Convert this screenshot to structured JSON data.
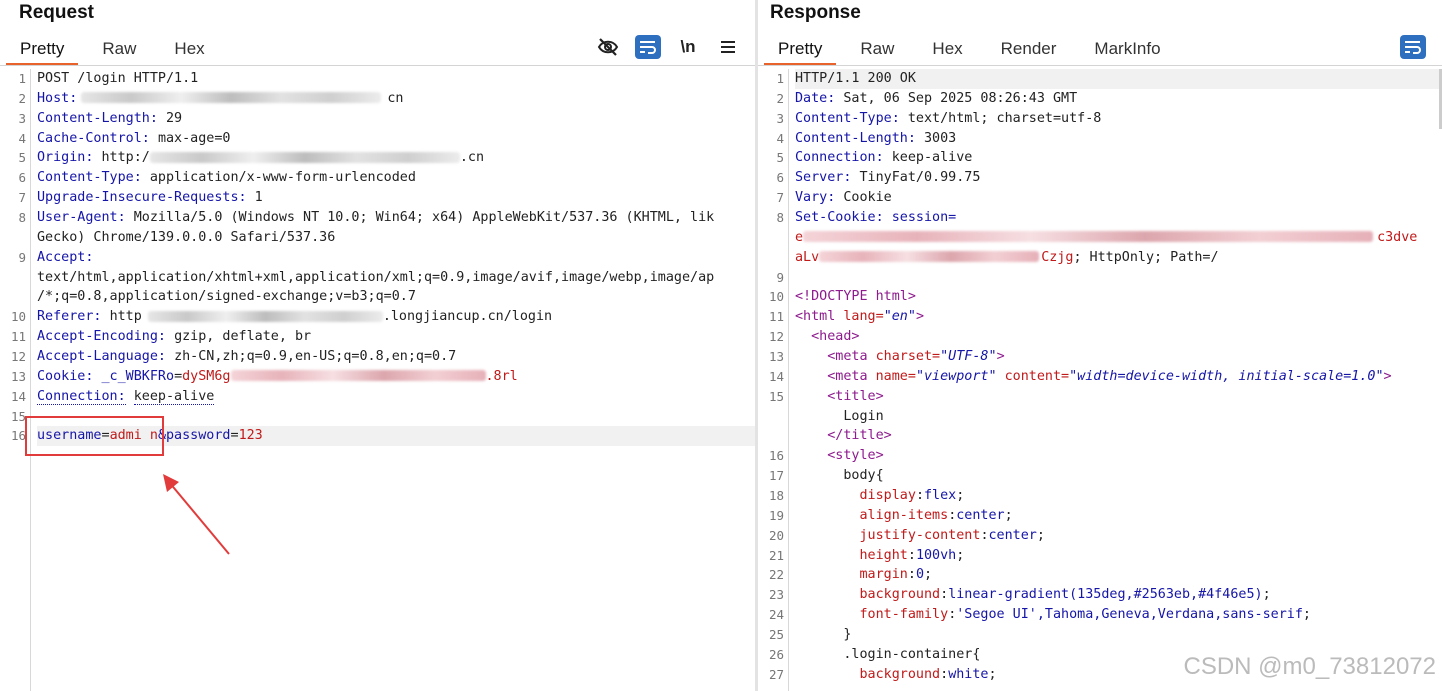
{
  "request": {
    "title": "Request",
    "tabs": [
      "Pretty",
      "Raw",
      "Hex"
    ],
    "toolbar": {
      "hide_icon": "eye-slash-icon",
      "wrap_icon": "wrap-lines-icon",
      "newline_label": "\\n",
      "menu_icon": "hamburger-menu-icon"
    },
    "lines": {
      "l1": "POST /login HTTP/1.1",
      "l2k": "Host:",
      "l2tail": "cn",
      "l3k": "Content-Length:",
      "l3v": "29",
      "l4k": "Cache-Control:",
      "l4v": "max-age=0",
      "l5k": "Origin:",
      "l5v": "http:/",
      "l5tail": ".cn",
      "l6k": "Content-Type:",
      "l6v": "application/x-www-form-urlencoded",
      "l7k": "Upgrade-Insecure-Requests:",
      "l7v": "1",
      "l8k": "User-Agent:",
      "l8v": "Mozilla/5.0 (Windows NT 10.0; Win64; x64) AppleWebKit/537.36 (KHTML, lik",
      "l8b": "Gecko) Chrome/139.0.0.0 Safari/537.36",
      "l9k": "Accept:",
      "l9b": "text/html,application/xhtml+xml,application/xml;q=0.9,image/avif,image/webp,image/ap",
      "l9c": "/*;q=0.8,application/signed-exchange;v=b3;q=0.7",
      "l10k": "Referer:",
      "l10v": "http",
      "l10tail": ".longjiancup.cn/login",
      "l11k": "Accept-Encoding:",
      "l11v": "gzip, deflate, br",
      "l12k": "Accept-Language:",
      "l12v": "zh-CN,zh;q=0.9,en-US;q=0.8,en;q=0.7",
      "l13k": "Cookie:",
      "l13n": "_c_WBKFRo",
      "l13v": "dySM6g",
      "l13tail": ".8rl",
      "l14k": "Connection:",
      "l14v": "keep-alive",
      "l16n": "username",
      "l16v": "admi n",
      "l16n2": "&password",
      "l16v2": "123"
    }
  },
  "response": {
    "title": "Response",
    "tabs": [
      "Pretty",
      "Raw",
      "Hex",
      "Render",
      "MarkInfo"
    ],
    "toolbar": {
      "wrap_icon": "wrap-lines-icon",
      "newline_label": "\\n"
    },
    "lines": {
      "l1": "HTTP/1.1 200 OK",
      "l2k": "Date:",
      "l2v": "Sat, 06 Sep 2025 08:26:43 GMT",
      "l3k": "Content-Type:",
      "l3v": "text/html; charset=utf-8",
      "l4k": "Content-Length:",
      "l4v": "3003",
      "l5k": "Connection:",
      "l5v": "keep-alive",
      "l6k": "Server:",
      "l6v": "TinyFat/0.99.75",
      "l7k": "Vary:",
      "l7v": "Cookie",
      "l8k": "Set-Cookie:",
      "l8n": "session=",
      "l8b1": "e",
      "l8b2": "c3dve",
      "l8c1": "aLv",
      "l8c2": "Czjg",
      "l8c3": "; HttpOnly; Path=/",
      "l10": "<!DOCTYPE html>",
      "l11a": "<html",
      "l11b": "lang=",
      "l11c": "\"en\"",
      "l11d": ">",
      "l12": "<head>",
      "l13a": "<meta",
      "l13b": "charset=",
      "l13c": "\"UTF-8\"",
      "l13d": ">",
      "l14a": "<meta",
      "l14b": "name=",
      "l14c": "\"viewport\"",
      "l14e": "content=",
      "l14f": "\"width=device-width, initial-scale=1.0\"",
      "l14d": ">",
      "l15": "<title>",
      "l15b": "Login",
      "l15c": "</title>",
      "l16": "<style>",
      "l17": "body{",
      "l18k": "display",
      "l18v": "flex",
      "l19k": "align-items",
      "l19v": "center",
      "l20k": "justify-content",
      "l20v": "center",
      "l21k": "height",
      "l21v": "100",
      "l21u": "vh",
      "l22k": "margin",
      "l22v": "0",
      "l23k": "background",
      "l23v": "linear-gradient(135deg,#2563eb,#4f46e5)",
      "l24k": "font-family",
      "l24v": "'Segoe UI',Tahoma,Geneva,Verdana,sans-serif",
      "l25": "}",
      "l26": ".login-container{",
      "l27k": "background",
      "l27v": "white"
    }
  },
  "watermark": "CSDN @m0_73812072"
}
